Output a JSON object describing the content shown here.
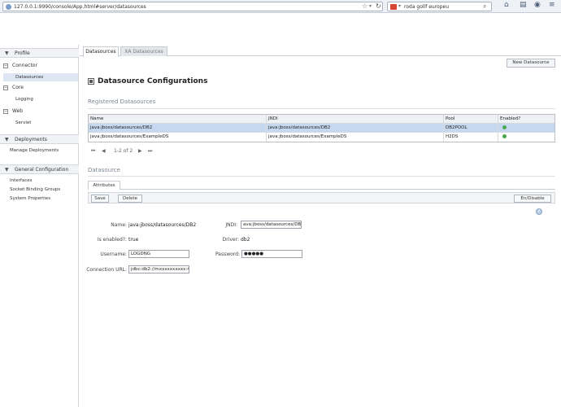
{
  "browser": {
    "url": "127.0.0.1:9990/console/App.html#server/datasources",
    "search_text": "roda gollf europeu",
    "icons": [
      "globe-icon",
      "star-icon",
      "reload-icon",
      "search-icon",
      "home-icon",
      "bookmark-icon",
      "menu-icon"
    ]
  },
  "nav": {
    "profile_header": "Profile",
    "groups": [
      {
        "label": "Connector",
        "items": [
          "Datasources"
        ]
      },
      {
        "label": "Core",
        "items": [
          "Logging"
        ]
      },
      {
        "label": "Web",
        "items": [
          "Servlet"
        ]
      }
    ],
    "deployments_header": "Deployments",
    "deployments_items": [
      "Manage Deployments"
    ],
    "general_header": "General Configuration",
    "general_items": [
      "Interfaces",
      "Socket Binding Groups",
      "System Properties"
    ]
  },
  "tabs": [
    "Datasources",
    "XA Datasources"
  ],
  "toolbar": {
    "new_datasource": "New Datasource"
  },
  "page_title": "Datasource Configurations",
  "registered": {
    "title": "Registered Datasources",
    "columns": [
      "Name",
      "JNDI",
      "Pool",
      "Enabled?"
    ],
    "rows": [
      {
        "name": "java:jboss/datasources/DB2",
        "jndi": "java:jboss/datasources/DB2",
        "pool": "DB2POOL",
        "enabled": true
      },
      {
        "name": "java:jboss/datasources/ExampleDS",
        "jndi": "java:jboss/datasources/ExampleDS",
        "pool": "H2DS",
        "enabled": true
      }
    ],
    "pager_text": "1-2 of 2",
    "enabled_color": "#4ca64c",
    "selected_row_color": "#c6d8ef"
  },
  "datasource": {
    "title": "Datasource",
    "tab": "Attributes",
    "save_label": "Save",
    "delete_label": "Delete",
    "endisable_label": "En/Disable",
    "fields": {
      "name_label": "Name:",
      "name_value": "java:jboss/datasources/DB2",
      "jndi_label": "JNDI:",
      "jndi_value": "ava:jboss/datasources/DB2",
      "enabled_label": "Is enabled?:",
      "enabled_value": "true",
      "driver_label": "Driver:",
      "driver_value": "db2",
      "username_label": "Username:",
      "username_value": "LOGDNG",
      "password_label": "Password:",
      "password_value": "●●●●●",
      "connurl_label": "Connection URL:",
      "connurl_value": "jdbc:db2://mxxxxxxxxxx:446/B"
    }
  }
}
